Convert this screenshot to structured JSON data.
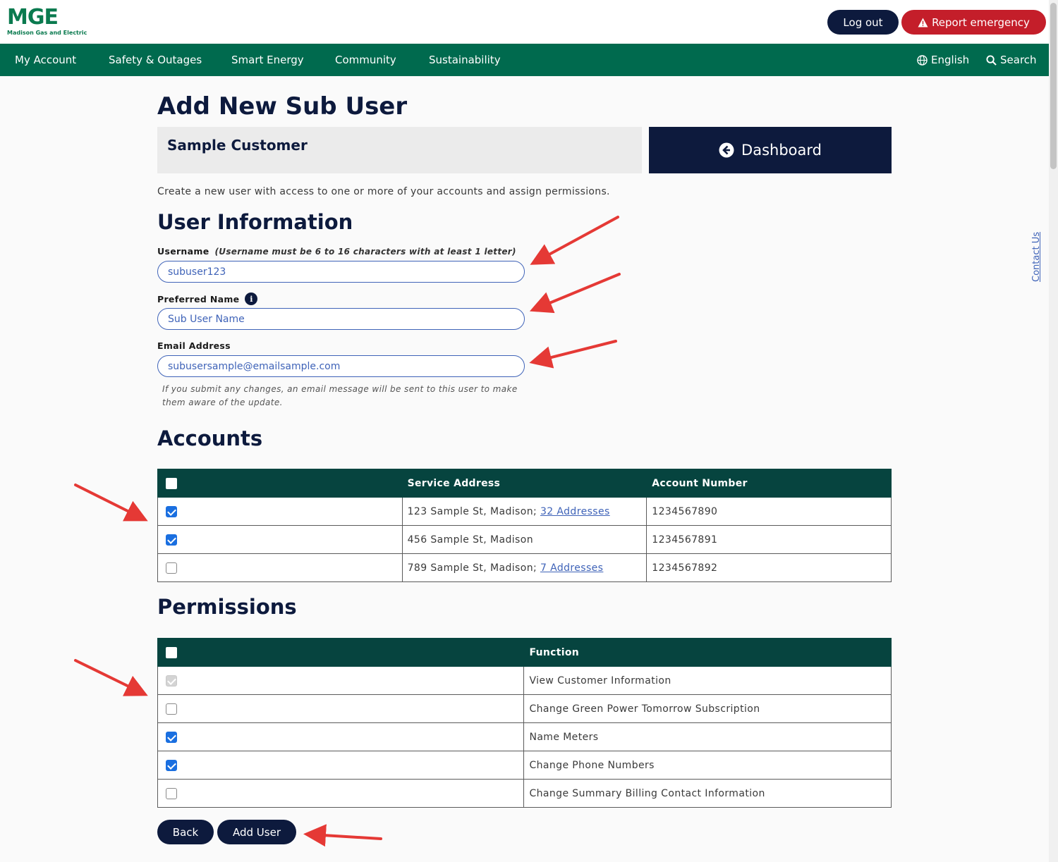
{
  "header": {
    "logo_text": "MGE",
    "logo_subtext": "Madison Gas and Electric",
    "logout_label": "Log out",
    "emergency_label": "Report emergency"
  },
  "nav": {
    "items": [
      "My Account",
      "Safety & Outages",
      "Smart Energy",
      "Community",
      "Sustainability"
    ],
    "language_label": "English",
    "search_label": "Search"
  },
  "side_tab": {
    "contact_label": "Contact Us"
  },
  "page": {
    "title": "Add New Sub User",
    "customer_name": "Sample Customer",
    "dashboard_label": "Dashboard",
    "intro": "Create a new user with access to one or more of your accounts and assign permissions."
  },
  "user_info": {
    "heading": "User Information",
    "username_label": "Username",
    "username_hint": "(Username must be 6 to 16 characters with at least 1 letter)",
    "username_value": "subuser123",
    "preferred_label": "Preferred Name",
    "preferred_value": "Sub User Name",
    "email_label": "Email Address",
    "email_value": "subusersample@emailsample.com",
    "email_note": "If you submit any changes, an email message will be sent to this user to make them aware of the update."
  },
  "accounts": {
    "heading": "Accounts",
    "columns": [
      "",
      "Service Address",
      "Account Number"
    ],
    "rows": [
      {
        "checked": true,
        "address": "123 Sample St, Madison;",
        "link": "32 Addresses",
        "account": "1234567890"
      },
      {
        "checked": true,
        "address": "456 Sample St, Madison",
        "link": "",
        "account": "1234567891"
      },
      {
        "checked": false,
        "address": "789 Sample St, Madison;",
        "link": "7 Addresses",
        "account": "1234567892"
      }
    ]
  },
  "permissions": {
    "heading": "Permissions",
    "columns": [
      "",
      "Function"
    ],
    "rows": [
      {
        "state": "disabled-checked",
        "function": "View Customer Information"
      },
      {
        "state": "unchecked",
        "function": "Change Green Power Tomorrow Subscription"
      },
      {
        "state": "checked",
        "function": "Name Meters"
      },
      {
        "state": "checked",
        "function": "Change Phone Numbers"
      },
      {
        "state": "unchecked",
        "function": "Change Summary Billing Contact Information"
      }
    ]
  },
  "actions": {
    "back_label": "Back",
    "add_user_label": "Add User"
  },
  "colors": {
    "nav_green": "#006a4e",
    "table_header": "#06443f",
    "navy": "#0d1a3d",
    "emergency_red": "#c41e2a",
    "link_blue": "#3f63b8",
    "checkbox_blue": "#1a6fe0",
    "annotation_arrow": "#e53935"
  },
  "icons": [
    "warning-icon",
    "globe-icon",
    "search-icon",
    "back-arrow-icon",
    "info-icon"
  ]
}
